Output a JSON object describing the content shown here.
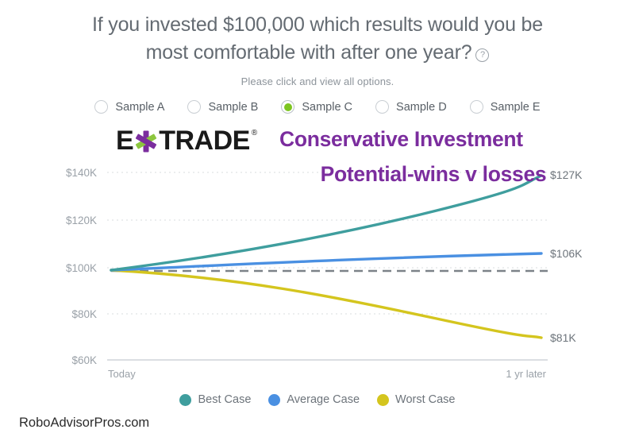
{
  "header": {
    "title_line1": "If you invested $100,000 which results would you be",
    "title_line2": "most comfortable with after one year?",
    "help_icon_glyph": "?",
    "subtitle": "Please click and view all options."
  },
  "samples": {
    "options": [
      {
        "label": "Sample A",
        "selected": false
      },
      {
        "label": "Sample B",
        "selected": false
      },
      {
        "label": "Sample C",
        "selected": true
      },
      {
        "label": "Sample D",
        "selected": false
      },
      {
        "label": "Sample E",
        "selected": false
      }
    ],
    "selected_value": "Sample C",
    "selected_color": "#7dc520"
  },
  "brand": {
    "name_part1": "E",
    "name_part2": "TRADE",
    "registered_mark": "®",
    "star_colors": [
      "#7b2d9e",
      "#8cc63e"
    ]
  },
  "annotation": {
    "line1": "Conservative Investment",
    "line2": "Potential-wins v losses",
    "color": "#7b2d9e"
  },
  "chart_data": {
    "type": "line",
    "title": "",
    "xlabel": "",
    "ylabel": "",
    "x": [
      "Today",
      "1 yr later"
    ],
    "xtick_labels": [
      "Today",
      "1 yr later"
    ],
    "ytick_labels": [
      "$140K",
      "$120K",
      "$100K",
      "$80K",
      "$60K"
    ],
    "ytick_values": [
      140000,
      120000,
      100000,
      80000,
      60000
    ],
    "ylim": [
      60000,
      145000
    ],
    "grid": true,
    "legend_position": "bottom",
    "baseline": {
      "value": 100000,
      "style": "dashed",
      "color": "#7c8288",
      "label": ""
    },
    "series": [
      {
        "name": "Best Case",
        "color": "#3f9e9e",
        "start_value": 100000,
        "end_value": 127000,
        "end_label": "$127K"
      },
      {
        "name": "Average Case",
        "color": "#4a90e2",
        "start_value": 100000,
        "end_value": 106000,
        "end_label": "$106K"
      },
      {
        "name": "Worst Case",
        "color": "#d4c51e",
        "start_value": 100000,
        "end_value": 81000,
        "end_label": "$81K"
      }
    ]
  },
  "legend": [
    {
      "label": "Best Case",
      "color": "#3f9e9e"
    },
    {
      "label": "Average Case",
      "color": "#4a90e2"
    },
    {
      "label": "Worst Case",
      "color": "#d4c51e"
    }
  ],
  "watermark": {
    "text": "RoboAdvisorPros.com"
  }
}
